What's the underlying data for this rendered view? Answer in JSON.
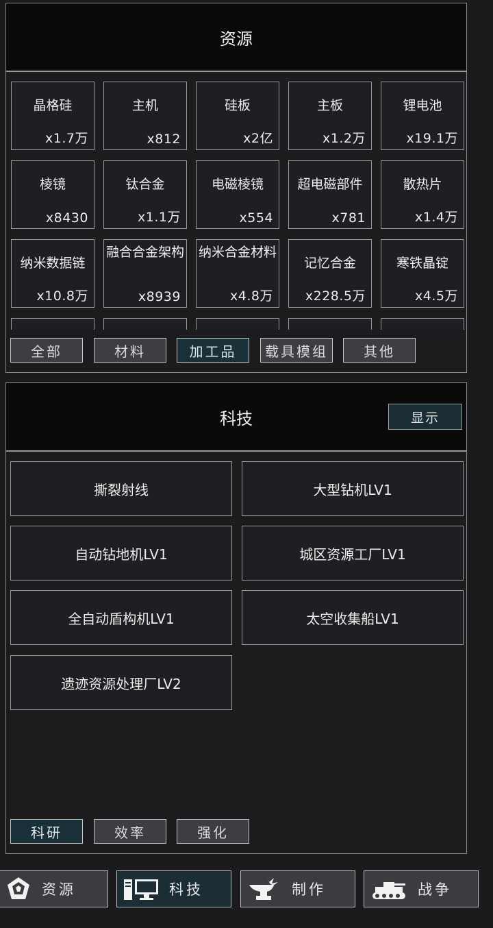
{
  "resources": {
    "title": "资源",
    "items": [
      {
        "name": "晶格硅",
        "count": "x1.7万"
      },
      {
        "name": "主机",
        "count": "x812"
      },
      {
        "name": "硅板",
        "count": "x2亿"
      },
      {
        "name": "主板",
        "count": "x1.2万"
      },
      {
        "name": "锂电池",
        "count": "x19.1万"
      },
      {
        "name": "棱镜",
        "count": "x8430"
      },
      {
        "name": "钛合金",
        "count": "x1.1万"
      },
      {
        "name": "电磁棱镜",
        "count": "x554"
      },
      {
        "name": "超电磁部件",
        "count": "x781"
      },
      {
        "name": "散热片",
        "count": "x1.4万"
      },
      {
        "name": "纳米数据链",
        "count": "x10.8万"
      },
      {
        "name": "融合合金架构",
        "count": "x8939"
      },
      {
        "name": "纳米合金材料",
        "count": "x4.8万"
      },
      {
        "name": "记忆合金",
        "count": "x228.5万"
      },
      {
        "name": "寒铁晶锭",
        "count": "x4.5万"
      }
    ],
    "tabs": [
      "全部",
      "材料",
      "加工品",
      "载具模组",
      "其他"
    ],
    "active_tab": "加工品"
  },
  "tech": {
    "title": "科技",
    "show_button": "显示",
    "items": [
      "撕裂射线",
      "大型钻机LV1",
      "自动钻地机LV1",
      "城区资源工厂LV1",
      "全自动盾构机LV1",
      "太空收集船LV1",
      "遗迹资源处理厂LV2"
    ],
    "tabs": [
      "科研",
      "效率",
      "强化"
    ],
    "active_tab": "科研"
  },
  "nav": {
    "items": [
      {
        "label": "资源",
        "icon": "gem-icon"
      },
      {
        "label": "科技",
        "icon": "computer-icon"
      },
      {
        "label": "制作",
        "icon": "anvil-icon"
      },
      {
        "label": "战争",
        "icon": "tank-icon"
      }
    ],
    "active": "科技"
  }
}
